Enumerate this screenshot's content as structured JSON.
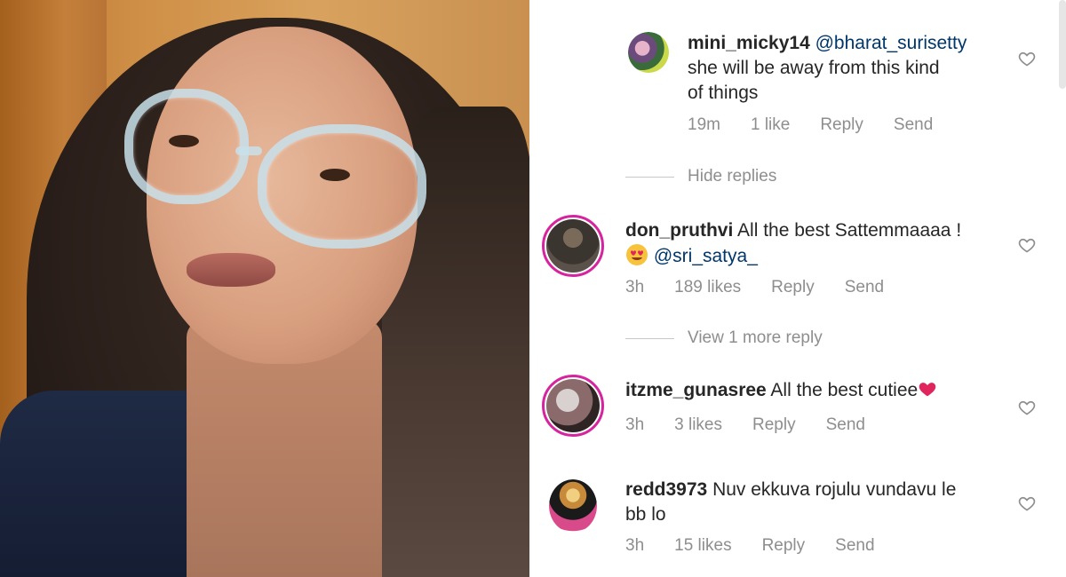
{
  "comments": [
    {
      "user": "mini_micky14",
      "mention": "@bharat_surisetty",
      "text_line1": "she will be away from this kind",
      "text_line2": "of things",
      "time": "19m",
      "likes": "1 like",
      "reply": "Reply",
      "send": "Send"
    },
    {
      "user": "don_pruthvi",
      "text": "All the best Sattemmaaaa !",
      "mention": "@sri_satya_",
      "time": "3h",
      "likes": "189 likes",
      "reply": "Reply",
      "send": "Send"
    },
    {
      "user": "itzme_gunasree",
      "text": "All the best cutiee",
      "time": "3h",
      "likes": "3 likes",
      "reply": "Reply",
      "send": "Send"
    },
    {
      "user": "redd3973",
      "text_line1": "Nuv ekkuva rojulu vundavu le",
      "text_line2": "bb lo",
      "time": "3h",
      "likes": "15 likes",
      "reply": "Reply",
      "send": "Send"
    }
  ],
  "hide_replies": "Hide replies",
  "view_more_reply": "View 1 more reply",
  "colors": {
    "text": "#262626",
    "meta": "#8e8e8e",
    "mention": "#00376b",
    "story_ring": "#d6249f"
  },
  "icons": [
    "heart-outline-icon",
    "heart-emoji",
    "heart-eyes-emoji"
  ]
}
